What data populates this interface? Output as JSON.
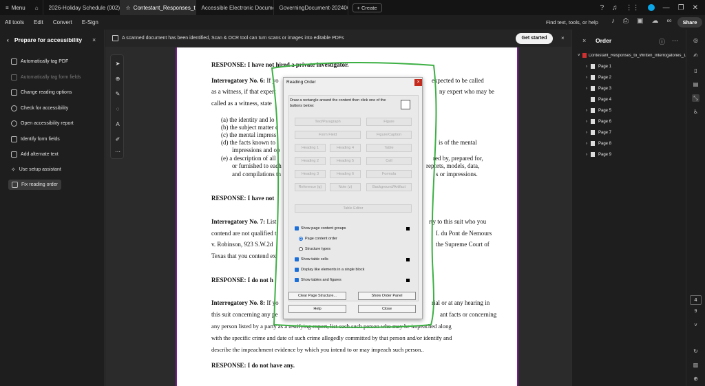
{
  "tabbar": {
    "menu_label": "Menu",
    "tabs": [
      {
        "label": "2026-Holiday Schedule (002) (1)...",
        "active": false
      },
      {
        "label": "Contestant_Responses_t...",
        "active": true
      },
      {
        "label": "Accessible Electronic Document ...",
        "active": false
      },
      {
        "label": "GoverningDocument-20240629...",
        "active": false
      }
    ],
    "create_label": "+ Create"
  },
  "menubar": {
    "items": [
      "All tools",
      "Edit",
      "Convert",
      "E-Sign"
    ],
    "find_label": "Find text, tools, or help",
    "share_label": "Share"
  },
  "left_panel": {
    "title": "Prepare for accessibility",
    "items": [
      {
        "label": "Automatically tag PDF",
        "enabled": true,
        "selected": false
      },
      {
        "label": "Automatically tag form fields",
        "enabled": false,
        "selected": false
      },
      {
        "label": "Change reading options",
        "enabled": true,
        "selected": false
      },
      {
        "label": "Check for accessibility",
        "enabled": true,
        "selected": false
      },
      {
        "label": "Open accessibility report",
        "enabled": true,
        "selected": false
      },
      {
        "label": "Identify form fields",
        "enabled": true,
        "selected": false
      },
      {
        "label": "Add alternate text",
        "enabled": true,
        "selected": false
      },
      {
        "label": "Use setup assistant",
        "enabled": true,
        "selected": false
      },
      {
        "label": "Fix reading order",
        "enabled": true,
        "selected": true
      }
    ]
  },
  "notice": {
    "text": "A scanned document has been identified, Scan & OCR tool can turn scans or images into editable PDFs",
    "button": "Get started"
  },
  "document": {
    "response1": "RESPONSE: I have not hired a private investigator.",
    "rog6_l1_bold": "Interrogatory No. 6:",
    "rog6_l1": " If yo",
    "rog6_l1_tail": "expected to be called",
    "rog6_l2": "as a witness, if that expert",
    "rog6_l2_tail": "ny expert who may be",
    "rog6_l3": "called as a witness, state",
    "list_a": "(a)  the identity and lo",
    "list_b": "(b)  the subject matter c",
    "list_c": "(c)  the mental impress",
    "list_d": "(d)  the facts known to",
    "list_d_tail": "is of the mental",
    "list_d2": "impressions and op",
    "list_e": "(e)  a description of all",
    "list_e_tail": "red by, prepared for,",
    "list_e2": "or furnished to each",
    "list_e2_tail": "reports, models, data,",
    "list_e3": "and compilations th",
    "list_e3_tail": "s or impressions.",
    "response2": "RESPONSE:   I have not",
    "rog7_bold": "Interrogatory No. 7:",
    "rog7_l1": " List",
    "rog7_l1_tail": "rty to this suit who you",
    "rog7_l2": "contend are not qualified t",
    "rog7_l2_tail": "I. du Pont de Nemours",
    "rog7_l3": "v. Robinson, 923 S.W.2d",
    "rog7_l3_tail": "the Supreme Court of",
    "rog7_l4": "Texas that you contend ex",
    "response3": "RESPONSE:   I do not h",
    "rog8_bold": "Interrogatory No. 8:",
    "rog8_l1": " If yo",
    "rog8_l1_tail": "rial or at any hearing in",
    "rog8_l2": "this suit concerning any pe",
    "rog8_l2_tail": "ant facts or concerning",
    "rog8_l3": "any person listed by a party as a testifying expert, list each such person who may be impeached along",
    "rog8_l4": "with the specific crime and date of such crime allegedly committed by that person and/or identify and",
    "rog8_l5": "describe the impeachment evidence by which you intend to or may impeach such person..",
    "response4": "RESPONSE: I do not have any."
  },
  "dialog": {
    "title": "Reading Order",
    "instruction": "Draw a rectangle around the content then click one of the buttons below:",
    "buttons": {
      "text_paragraph": "Text/Paragraph",
      "figure": "Figure",
      "form_field": "Form Field",
      "figure_caption": "Figure/Caption",
      "heading1": "Heading 1",
      "heading4": "Heading 4",
      "table": "Table",
      "heading2": "Heading 2",
      "heading5": "Heading 5",
      "cell": "Cell",
      "heading3": "Heading 3",
      "heading6": "Heading 6",
      "formula": "Formula",
      "reference": "Reference (q)",
      "note": "Note (z)",
      "background": "Background/Artifact",
      "table_editor": "Table Editor",
      "clear": "Clear Page Structure...",
      "show_order": "Show Order Panel",
      "help": "Help",
      "close": "Close"
    },
    "options": {
      "show_page_content_groups": "Show page content groups",
      "page_content_order": "Page content order",
      "structure_types": "Structure types",
      "show_table_cells": "Show table cells",
      "display_like_elements": "Display like elements in a single block",
      "show_tables_figures": "Show tables and figures"
    }
  },
  "order_panel": {
    "title": "Order",
    "doc_name": "Contestant_Responses_to_Written_Interrogatories_1",
    "pages": [
      {
        "label": "Page 1",
        "expandable": true
      },
      {
        "label": "Page 2",
        "expandable": true
      },
      {
        "label": "Page 3",
        "expandable": true
      },
      {
        "label": "Page 4",
        "expandable": false
      },
      {
        "label": "Page 5",
        "expandable": true
      },
      {
        "label": "Page 6",
        "expandable": true
      },
      {
        "label": "Page 7",
        "expandable": true
      },
      {
        "label": "Page 8",
        "expandable": true
      },
      {
        "label": "Page 9",
        "expandable": true
      }
    ]
  },
  "pager": {
    "current": "4",
    "total": "9"
  },
  "colors": {
    "accent": "#1a6fd8",
    "page_border": "#7a1d8f",
    "annotation": "#3cb043",
    "close_red": "#c42b1c"
  }
}
